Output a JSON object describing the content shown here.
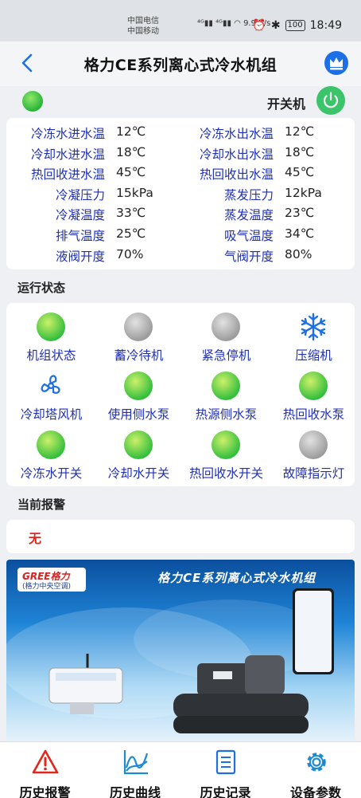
{
  "statusbar": {
    "carrier_line1": "中国电信",
    "carrier_line2": "中国移动",
    "net_speed": "9.9 K/s",
    "battery": "100",
    "time": "18:49"
  },
  "header": {
    "title": "格力CE系列离心式冷水机组"
  },
  "switch": {
    "label": "开关机",
    "indicator_color": "#32be3c",
    "button_color": "#3cc46a"
  },
  "params": [
    {
      "label": "冷冻水进水温",
      "value": "12℃",
      "label2": "冷冻水出水温",
      "value2": "12℃"
    },
    {
      "label": "冷却水进水温",
      "value": "18℃",
      "label2": "冷却水出水温",
      "value2": "18℃"
    },
    {
      "label": "热回收进水温",
      "value": "45℃",
      "label2": "热回收出水温",
      "value2": "45℃"
    },
    {
      "label": "冷凝压力",
      "value": "15kPa",
      "label2": "蒸发压力",
      "value2": "12kPa"
    },
    {
      "label": "冷凝温度",
      "value": "33℃",
      "label2": "蒸发温度",
      "value2": "23℃"
    },
    {
      "label": "排气温度",
      "value": "25℃",
      "label2": "吸气温度",
      "value2": "34℃"
    },
    {
      "label": "液阀开度",
      "value": "70%",
      "label2": "气阀开度",
      "value2": "80%"
    }
  ],
  "run_status": {
    "title": "运行状态",
    "items": [
      {
        "label": "机组状态",
        "state": "green",
        "icon": "status-ball"
      },
      {
        "label": "蓄冷待机",
        "state": "gray",
        "icon": "status-ball"
      },
      {
        "label": "紧急停机",
        "state": "gray",
        "icon": "status-ball"
      },
      {
        "label": "压缩机",
        "state": "snowflake",
        "icon": "snowflake-icon"
      },
      {
        "label": "冷却塔风机",
        "state": "fan",
        "icon": "fan-icon"
      },
      {
        "label": "使用侧水泵",
        "state": "green",
        "icon": "status-ball"
      },
      {
        "label": "热源侧水泵",
        "state": "green",
        "icon": "status-ball"
      },
      {
        "label": "热回收水泵",
        "state": "green",
        "icon": "status-ball"
      },
      {
        "label": "冷冻水开关",
        "state": "green",
        "icon": "status-ball"
      },
      {
        "label": "冷却水开关",
        "state": "green",
        "icon": "status-ball"
      },
      {
        "label": "热回收水开关",
        "state": "green",
        "icon": "status-ball"
      },
      {
        "label": "故障指示灯",
        "state": "gray",
        "icon": "status-ball"
      }
    ]
  },
  "alarm": {
    "title": "当前报警",
    "value": "无"
  },
  "banner": {
    "brand": "GREE格力",
    "brand_sub": "(格力中央空调)",
    "title": "格力CE系列离心式冷水机组"
  },
  "bottom_nav": [
    {
      "label": "历史报警",
      "icon": "alarm-warning-icon"
    },
    {
      "label": "历史曲线",
      "icon": "chart-curve-icon"
    },
    {
      "label": "历史记录",
      "icon": "record-list-icon"
    },
    {
      "label": "设备参数",
      "icon": "gear-icon"
    }
  ],
  "colors": {
    "accent_blue": "#1f30b8",
    "alarm_red": "#e1261c",
    "green": "#32be3c",
    "gray": "#9b9b9b"
  }
}
